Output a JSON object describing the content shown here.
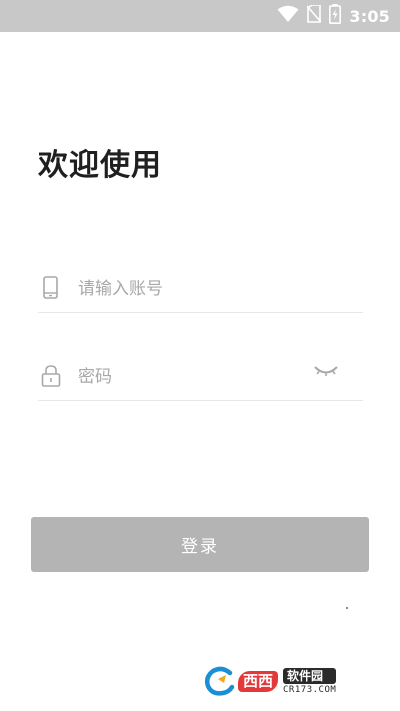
{
  "status_bar": {
    "time": "3:05",
    "icons": [
      "wifi-icon",
      "no-sim-icon",
      "battery-charging-icon"
    ],
    "background": "#c8c8c8"
  },
  "welcome": {
    "title": "欢迎使用"
  },
  "account_field": {
    "icon": "phone-icon",
    "placeholder": "请输入账号",
    "value": ""
  },
  "password_field": {
    "icon": "lock-icon",
    "placeholder": "密码",
    "value": "",
    "toggle_icon": "eye-closed-icon"
  },
  "login_button": {
    "label": "登录",
    "color": "#b4b4b4"
  },
  "watermark": {
    "brand": "西西",
    "name": "软件园",
    "domain": "CR173.COM"
  }
}
